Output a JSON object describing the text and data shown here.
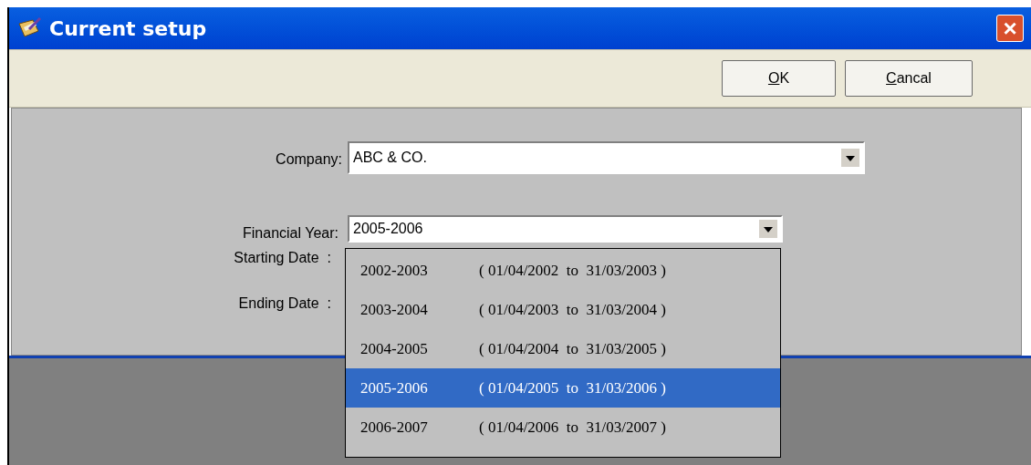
{
  "window": {
    "title": "Current setup",
    "close": "×"
  },
  "buttons": [
    {
      "label": "OK",
      "first_letter_underlined": true
    },
    {
      "label": "Cancal",
      "first_letter_underlined": true
    }
  ],
  "fields": [
    {
      "label": "Company:",
      "value": "ABC & CO."
    },
    {
      "label": "Financial Year:",
      "value": "2005-2006"
    }
  ],
  "date_labels": [
    "Starting Date  :",
    "Ending Date  :"
  ],
  "dropdown": [
    {
      "year": "2002-2003",
      "range": "( 01/04/2002  to  31/03/2003 )",
      "selected": false
    },
    {
      "year": "2003-2004",
      "range": "( 01/04/2003  to  31/03/2004 )",
      "selected": false
    },
    {
      "year": "2004-2005",
      "range": "( 01/04/2004  to  31/03/2005 )",
      "selected": false
    },
    {
      "year": "2005-2006",
      "range": "( 01/04/2005  to  31/03/2006 )",
      "selected": true
    },
    {
      "year": "2006-2007",
      "range": "( 01/04/2006  to  31/03/2007 )",
      "selected": false
    }
  ]
}
